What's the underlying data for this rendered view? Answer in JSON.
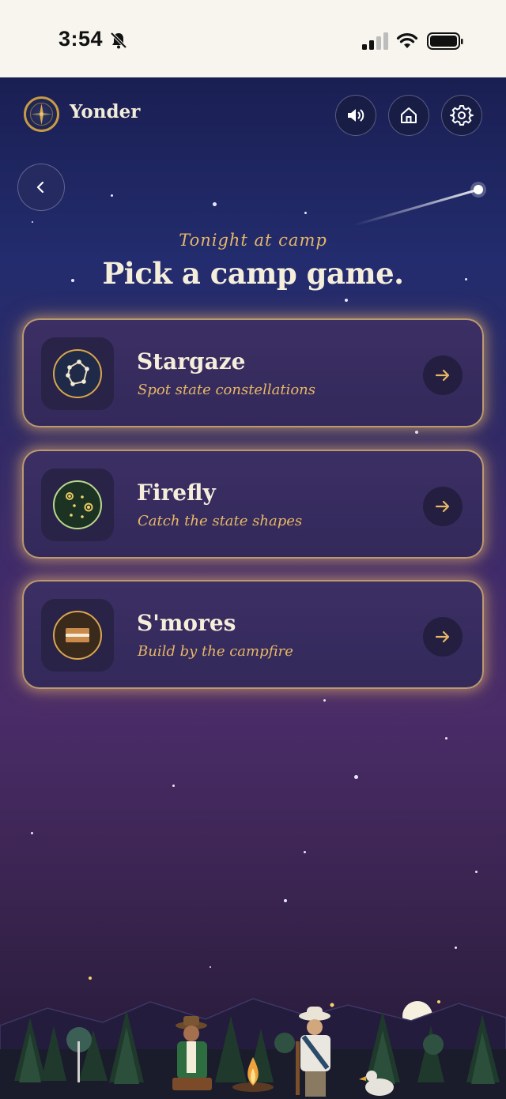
{
  "status_bar": {
    "time": "3:54"
  },
  "header": {
    "app_name": "Yonder",
    "sound_icon": "speaker-icon",
    "home_icon": "home-icon",
    "settings_icon": "gear-icon"
  },
  "nav": {
    "back_icon": "chevron-left-icon"
  },
  "main": {
    "subtitle": "Tonight at camp",
    "title": "Pick a camp game."
  },
  "games": [
    {
      "title": "Stargaze",
      "subtitle": "Spot state constellations",
      "icon": "constellation-icon"
    },
    {
      "title": "Firefly",
      "subtitle": "Catch the state shapes",
      "icon": "firefly-icon"
    },
    {
      "title": "S'mores",
      "subtitle": "Build by the campfire",
      "icon": "smores-icon"
    }
  ],
  "colors": {
    "accent_gold": "#e6b766",
    "title_cream": "#f5eedb",
    "card_bg": "#3c2f64",
    "sky_top": "#1a1f52",
    "sky_bottom": "#231a35"
  }
}
